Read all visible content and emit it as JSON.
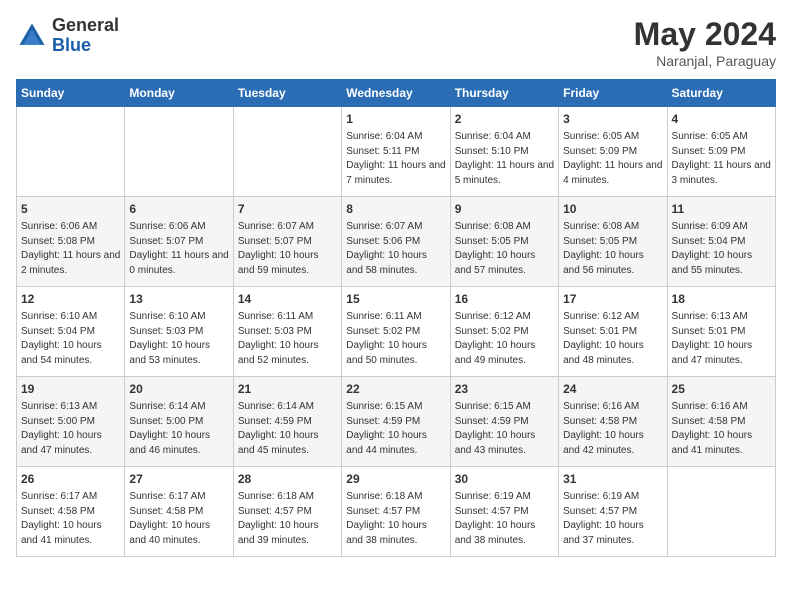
{
  "header": {
    "logo_general": "General",
    "logo_blue": "Blue",
    "month_year": "May 2024",
    "location": "Naranjal, Paraguay"
  },
  "weekdays": [
    "Sunday",
    "Monday",
    "Tuesday",
    "Wednesday",
    "Thursday",
    "Friday",
    "Saturday"
  ],
  "weeks": [
    [
      {
        "day": "",
        "info": ""
      },
      {
        "day": "",
        "info": ""
      },
      {
        "day": "",
        "info": ""
      },
      {
        "day": "1",
        "info": "Sunrise: 6:04 AM\nSunset: 5:11 PM\nDaylight: 11 hours and 7 minutes."
      },
      {
        "day": "2",
        "info": "Sunrise: 6:04 AM\nSunset: 5:10 PM\nDaylight: 11 hours and 5 minutes."
      },
      {
        "day": "3",
        "info": "Sunrise: 6:05 AM\nSunset: 5:09 PM\nDaylight: 11 hours and 4 minutes."
      },
      {
        "day": "4",
        "info": "Sunrise: 6:05 AM\nSunset: 5:09 PM\nDaylight: 11 hours and 3 minutes."
      }
    ],
    [
      {
        "day": "5",
        "info": "Sunrise: 6:06 AM\nSunset: 5:08 PM\nDaylight: 11 hours and 2 minutes."
      },
      {
        "day": "6",
        "info": "Sunrise: 6:06 AM\nSunset: 5:07 PM\nDaylight: 11 hours and 0 minutes."
      },
      {
        "day": "7",
        "info": "Sunrise: 6:07 AM\nSunset: 5:07 PM\nDaylight: 10 hours and 59 minutes."
      },
      {
        "day": "8",
        "info": "Sunrise: 6:07 AM\nSunset: 5:06 PM\nDaylight: 10 hours and 58 minutes."
      },
      {
        "day": "9",
        "info": "Sunrise: 6:08 AM\nSunset: 5:05 PM\nDaylight: 10 hours and 57 minutes."
      },
      {
        "day": "10",
        "info": "Sunrise: 6:08 AM\nSunset: 5:05 PM\nDaylight: 10 hours and 56 minutes."
      },
      {
        "day": "11",
        "info": "Sunrise: 6:09 AM\nSunset: 5:04 PM\nDaylight: 10 hours and 55 minutes."
      }
    ],
    [
      {
        "day": "12",
        "info": "Sunrise: 6:10 AM\nSunset: 5:04 PM\nDaylight: 10 hours and 54 minutes."
      },
      {
        "day": "13",
        "info": "Sunrise: 6:10 AM\nSunset: 5:03 PM\nDaylight: 10 hours and 53 minutes."
      },
      {
        "day": "14",
        "info": "Sunrise: 6:11 AM\nSunset: 5:03 PM\nDaylight: 10 hours and 52 minutes."
      },
      {
        "day": "15",
        "info": "Sunrise: 6:11 AM\nSunset: 5:02 PM\nDaylight: 10 hours and 50 minutes."
      },
      {
        "day": "16",
        "info": "Sunrise: 6:12 AM\nSunset: 5:02 PM\nDaylight: 10 hours and 49 minutes."
      },
      {
        "day": "17",
        "info": "Sunrise: 6:12 AM\nSunset: 5:01 PM\nDaylight: 10 hours and 48 minutes."
      },
      {
        "day": "18",
        "info": "Sunrise: 6:13 AM\nSunset: 5:01 PM\nDaylight: 10 hours and 47 minutes."
      }
    ],
    [
      {
        "day": "19",
        "info": "Sunrise: 6:13 AM\nSunset: 5:00 PM\nDaylight: 10 hours and 47 minutes."
      },
      {
        "day": "20",
        "info": "Sunrise: 6:14 AM\nSunset: 5:00 PM\nDaylight: 10 hours and 46 minutes."
      },
      {
        "day": "21",
        "info": "Sunrise: 6:14 AM\nSunset: 4:59 PM\nDaylight: 10 hours and 45 minutes."
      },
      {
        "day": "22",
        "info": "Sunrise: 6:15 AM\nSunset: 4:59 PM\nDaylight: 10 hours and 44 minutes."
      },
      {
        "day": "23",
        "info": "Sunrise: 6:15 AM\nSunset: 4:59 PM\nDaylight: 10 hours and 43 minutes."
      },
      {
        "day": "24",
        "info": "Sunrise: 6:16 AM\nSunset: 4:58 PM\nDaylight: 10 hours and 42 minutes."
      },
      {
        "day": "25",
        "info": "Sunrise: 6:16 AM\nSunset: 4:58 PM\nDaylight: 10 hours and 41 minutes."
      }
    ],
    [
      {
        "day": "26",
        "info": "Sunrise: 6:17 AM\nSunset: 4:58 PM\nDaylight: 10 hours and 41 minutes."
      },
      {
        "day": "27",
        "info": "Sunrise: 6:17 AM\nSunset: 4:58 PM\nDaylight: 10 hours and 40 minutes."
      },
      {
        "day": "28",
        "info": "Sunrise: 6:18 AM\nSunset: 4:57 PM\nDaylight: 10 hours and 39 minutes."
      },
      {
        "day": "29",
        "info": "Sunrise: 6:18 AM\nSunset: 4:57 PM\nDaylight: 10 hours and 38 minutes."
      },
      {
        "day": "30",
        "info": "Sunrise: 6:19 AM\nSunset: 4:57 PM\nDaylight: 10 hours and 38 minutes."
      },
      {
        "day": "31",
        "info": "Sunrise: 6:19 AM\nSunset: 4:57 PM\nDaylight: 10 hours and 37 minutes."
      },
      {
        "day": "",
        "info": ""
      }
    ]
  ]
}
